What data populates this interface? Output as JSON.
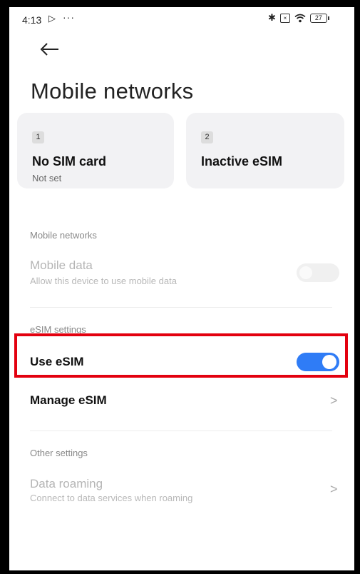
{
  "status_bar": {
    "time": "4:13",
    "play_glyph": "▷",
    "dots": "···",
    "bluetooth_glyph": "✱",
    "sim_glyph": "×",
    "wifi_glyph": "◔",
    "battery": "27"
  },
  "header": {
    "title": "Mobile networks"
  },
  "sim_cards": [
    {
      "slot": "1",
      "name": "No SIM card",
      "status": "Not set"
    },
    {
      "slot": "2",
      "name": "Inactive eSIM",
      "status": ""
    }
  ],
  "mobile_networks_section": {
    "label": "Mobile networks",
    "mobile_data": {
      "title": "Mobile data",
      "subtitle": "Allow this device to use mobile data",
      "enabled": false
    }
  },
  "esim_section": {
    "label": "eSIM settings",
    "use_esim": {
      "title": "Use eSIM",
      "enabled": true
    },
    "manage_esim": {
      "title": "Manage eSIM",
      "chevron": ">"
    }
  },
  "other_section": {
    "label": "Other settings",
    "data_roaming": {
      "title": "Data roaming",
      "subtitle": "Connect to data services when roaming",
      "chevron": ">"
    }
  },
  "colors": {
    "accent": "#2f7cf6",
    "highlight": "#e3000f"
  }
}
